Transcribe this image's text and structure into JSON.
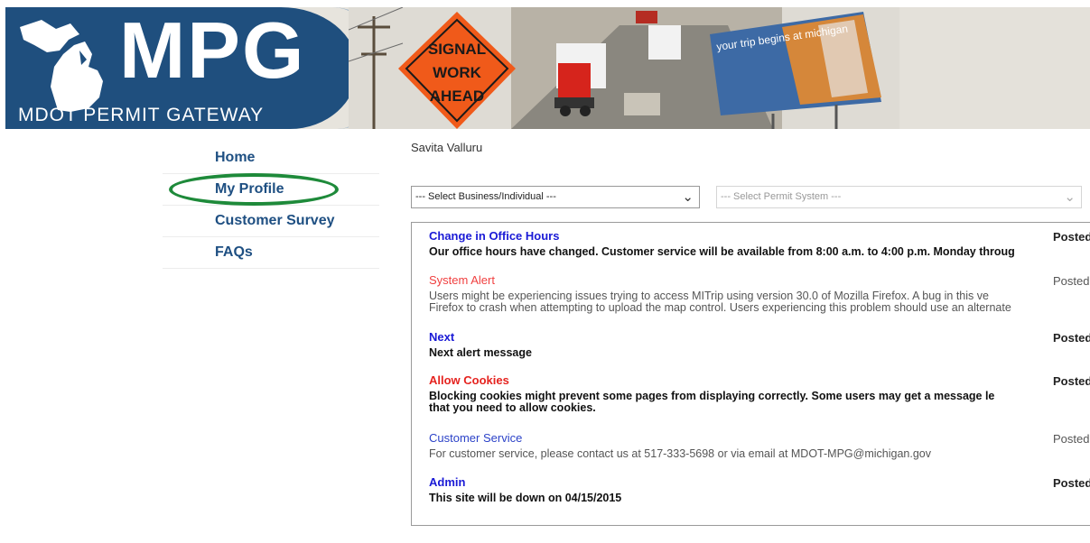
{
  "header": {
    "logo_text": "MPG",
    "logo_subtitle": "MDOT PERMIT GATEWAY",
    "sign_text": [
      "SIGNAL",
      "WORK",
      "AHEAD"
    ],
    "billboard_text": "your trip begins at michigan"
  },
  "sidebar": {
    "items": [
      {
        "label": "Home"
      },
      {
        "label": "My Profile"
      },
      {
        "label": "Customer Survey"
      },
      {
        "label": "FAQs"
      }
    ]
  },
  "main": {
    "user_name": "Savita Valluru",
    "business_select": "--- Select Business/Individual ---",
    "permit_select": "--- Select Permit System ---"
  },
  "alerts": [
    {
      "title": "Change in Office Hours",
      "posted": "Posted I",
      "body": [
        "Our office hours have changed. Customer service will be available from 8:00 a.m. to 4:00 p.m. Monday throug"
      ]
    },
    {
      "title": "System Alert",
      "posted": "Posted F",
      "body": [
        "Users might be experiencing issues trying to access MITrip using version 30.0 of Mozilla Firefox. A bug in this ve",
        "Firefox to crash when attempting to upload the map control. Users experiencing this problem should use an alternate"
      ]
    },
    {
      "title": "Next",
      "posted": "Posted A",
      "body": [
        "Next alert message"
      ]
    },
    {
      "title": "Allow Cookies",
      "posted": "Posted I",
      "body": [
        "Blocking cookies might prevent some pages from displaying correctly. Some users may get a message le",
        "that you need to allow cookies."
      ]
    },
    {
      "title": "Customer Service",
      "posted": "Posted F",
      "body": [
        "For customer service, please contact us at 517-333-5698 or via email at MDOT-MPG@michigan.gov"
      ]
    },
    {
      "title": "Admin",
      "posted": "Posted A",
      "body": [
        "This site will be down on 04/15/2015"
      ]
    }
  ],
  "colors": {
    "brand_blue": "#1f4f7e",
    "nav_blue": "#1e4f82",
    "highlight_green": "#1e8a3a",
    "alert_blue": "#1a1ad6",
    "alert_red": "#e5231f"
  }
}
